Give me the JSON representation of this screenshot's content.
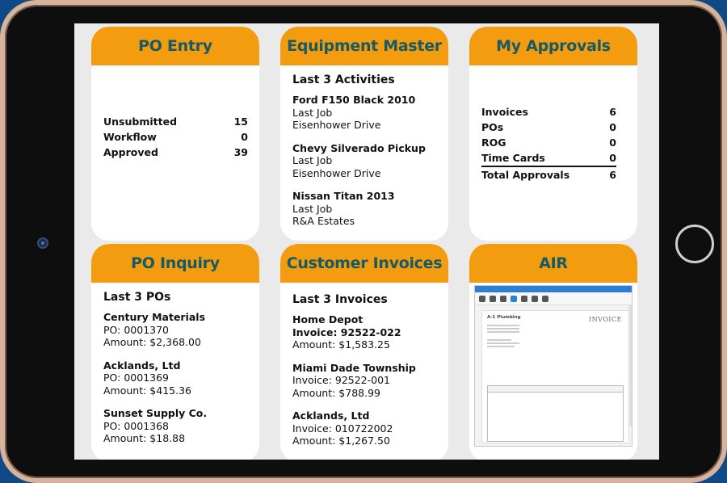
{
  "po_entry": {
    "title": "PO Entry",
    "rows": [
      {
        "label": "Unsubmitted",
        "value": "15"
      },
      {
        "label": "Workflow",
        "value": "0"
      },
      {
        "label": "Approved",
        "value": "39"
      }
    ]
  },
  "equipment_master": {
    "title": "Equipment Master",
    "section": "Last 3 Activities",
    "items": [
      {
        "name": "Ford F150 Black 2010",
        "line1": "Last Job",
        "line2": "Eisenhower Drive"
      },
      {
        "name": "Chevy Silverado Pickup",
        "line1": "Last Job",
        "line2": "Eisenhower Drive"
      },
      {
        "name": "Nissan Titan 2013",
        "line1": "Last Job",
        "line2": "R&A Estates"
      }
    ]
  },
  "my_approvals": {
    "title": "My Approvals",
    "rows": [
      {
        "label": "Invoices",
        "value": "6"
      },
      {
        "label": "POs",
        "value": "0"
      },
      {
        "label": "ROG",
        "value": "0"
      },
      {
        "label": "Time Cards",
        "value": "0"
      }
    ],
    "total": {
      "label": "Total Approvals",
      "value": "6"
    }
  },
  "po_inquiry": {
    "title": "PO Inquiry",
    "section": "Last 3 POs",
    "items": [
      {
        "name": "Century Materials",
        "line1": "PO: 0001370",
        "line2": "Amount: $2,368.00"
      },
      {
        "name": "Acklands, Ltd",
        "line1": "PO: 0001369",
        "line2": "Amount: $415.36"
      },
      {
        "name": "Sunset Supply Co.",
        "line1": "PO: 0001368",
        "line2": "Amount: $18.88"
      }
    ]
  },
  "customer_invoices": {
    "title": "Customer Invoices",
    "section": "Last 3 Invoices",
    "items": [
      {
        "name": "Home Depot",
        "line1": "Invoice: 92522-022",
        "line2": "Amount: $1,583.25",
        "line1_bold": true
      },
      {
        "name": "Miami Dade Township",
        "line1": "Invoice: 92522-001",
        "line2": "Amount: $788.99"
      },
      {
        "name": "Acklands, Ltd",
        "line1": "Invoice: 010722002",
        "line2": "Amount: $1,267.50"
      }
    ]
  },
  "air": {
    "title": "AIR",
    "preview": {
      "company": "A-1 Plumbing",
      "doc_title": "INVOICE"
    }
  },
  "colors": {
    "header": "#f49c10",
    "title_text": "#155a64",
    "background": "#0f4a86",
    "bezel": "#d8b39c"
  }
}
